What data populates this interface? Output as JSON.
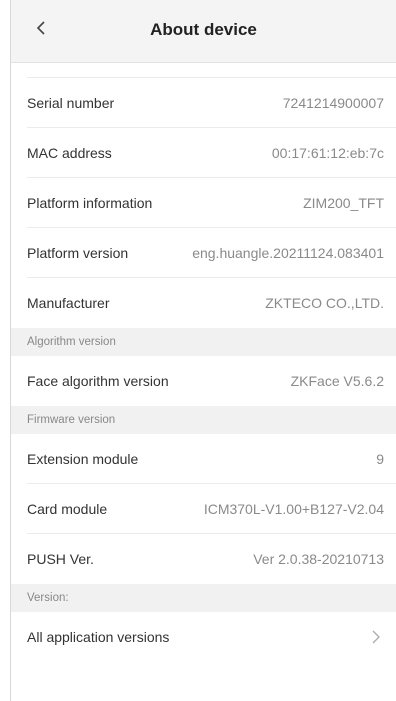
{
  "header": {
    "title": "About device"
  },
  "rows_group1": [
    {
      "label": "Serial number",
      "value": "7241214900007"
    },
    {
      "label": "MAC address",
      "value": "00:17:61:12:eb:7c"
    },
    {
      "label": "Platform information",
      "value": "ZIM200_TFT"
    },
    {
      "label": "Platform version",
      "value": "eng.huangle.20211124.083401"
    },
    {
      "label": "Manufacturer",
      "value": "ZKTECO CO.,LTD."
    }
  ],
  "section_algorithm": {
    "title": "Algorithm version"
  },
  "rows_group2": [
    {
      "label": "Face algorithm version",
      "value": "ZKFace V5.6.2"
    }
  ],
  "section_firmware": {
    "title": "Firmware version"
  },
  "rows_group3": [
    {
      "label": "Extension module",
      "value": "9"
    },
    {
      "label": "Card module",
      "value": "ICM370L-V1.00+B127-V2.04"
    },
    {
      "label": "PUSH Ver.",
      "value": "Ver 2.0.38-20210713"
    }
  ],
  "section_version": {
    "title": "Version:"
  },
  "rows_group4": [
    {
      "label": "All application versions"
    }
  ],
  "icons": {
    "back": "chevron-left-icon",
    "forward": "chevron-right-icon"
  }
}
